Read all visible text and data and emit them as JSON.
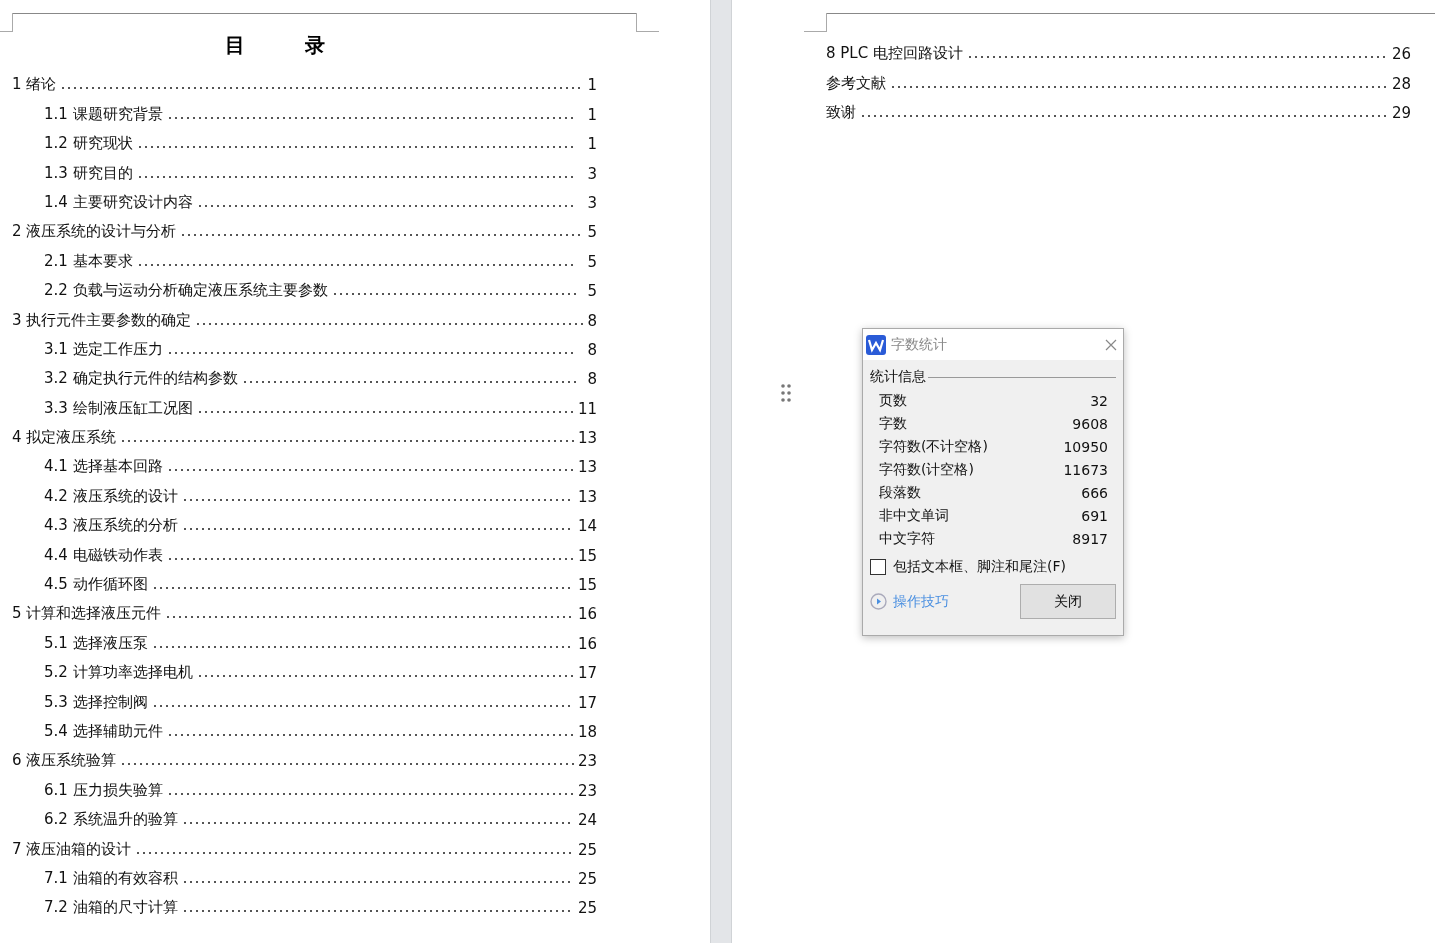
{
  "left_page": {
    "title": "目　　　录",
    "entries": [
      {
        "label": "1 绪论",
        "page": "1",
        "children": [
          {
            "label": "1.1 课题研究背景",
            "page": "1"
          },
          {
            "label": "1.2 研究现状",
            "page": "1"
          },
          {
            "label": "1.3 研究目的",
            "page": "3"
          },
          {
            "label": "1.4 主要研究设计内容",
            "page": "3"
          }
        ]
      },
      {
        "label": "2 液压系统的设计与分析",
        "page": "5",
        "children": [
          {
            "label": "2.1 基本要求",
            "page": "5"
          },
          {
            "label": "2.2 负载与运动分析确定液压系统主要参数",
            "page": "5"
          }
        ]
      },
      {
        "label": "3 执行元件主要参数的确定",
        "page": "8",
        "children": [
          {
            "label": "3.1 选定工作压力",
            "page": "8"
          },
          {
            "label": "3.2 确定执行元件的结构参数",
            "page": "8"
          },
          {
            "label": "3.3 绘制液压缸工况图",
            "page": "11"
          }
        ]
      },
      {
        "label": "4 拟定液压系统",
        "page": "13",
        "children": [
          {
            "label": "4.1 选择基本回路",
            "page": "13"
          },
          {
            "label": "4.2 液压系统的设计",
            "page": "13"
          },
          {
            "label": "4.3 液压系统的分析",
            "page": "14"
          },
          {
            "label": "4.4 电磁铁动作表",
            "page": "15"
          },
          {
            "label": "4.5 动作循环图",
            "page": "15"
          }
        ]
      },
      {
        "label": "5 计算和选择液压元件",
        "page": "16",
        "children": [
          {
            "label": "5.1 选择液压泵",
            "page": "16"
          },
          {
            "label": "5.2 计算功率选择电机",
            "page": "17"
          },
          {
            "label": "5.3 选择控制阀",
            "page": "17"
          },
          {
            "label": "5.4 选择辅助元件",
            "page": "18"
          }
        ]
      },
      {
        "label": "6 液压系统验算",
        "page": "23",
        "children": [
          {
            "label": "6.1 压力损失验算",
            "page": "23"
          },
          {
            "label": "6.2 系统温升的验算",
            "page": "24"
          }
        ]
      },
      {
        "label": "7 液压油箱的设计",
        "page": "25",
        "children": [
          {
            "label": "7.1 油箱的有效容积",
            "page": "25"
          },
          {
            "label": "7.2 油箱的尺寸计算",
            "page": "25"
          }
        ]
      }
    ]
  },
  "right_page": {
    "entries": [
      {
        "label": "8 PLC 电控回路设计",
        "page": "26"
      },
      {
        "label": "参考文献",
        "page": "28"
      },
      {
        "label": "致谢",
        "page": "29"
      }
    ]
  },
  "dialog": {
    "title": "字数统计",
    "section": "统计信息",
    "stats": [
      {
        "label": "页数",
        "value": "32"
      },
      {
        "label": "字数",
        "value": "9608"
      },
      {
        "label": "字符数(不计空格)",
        "value": "10950"
      },
      {
        "label": "字符数(计空格)",
        "value": "11673"
      },
      {
        "label": "段落数",
        "value": "666"
      },
      {
        "label": "非中文单词",
        "value": "691"
      },
      {
        "label": "中文字符",
        "value": "8917"
      }
    ],
    "checkbox": {
      "label": "包括文本框、脚注和尾注(F)",
      "checked": false
    },
    "tips_link": "操作技巧",
    "close_button": "关闭"
  }
}
